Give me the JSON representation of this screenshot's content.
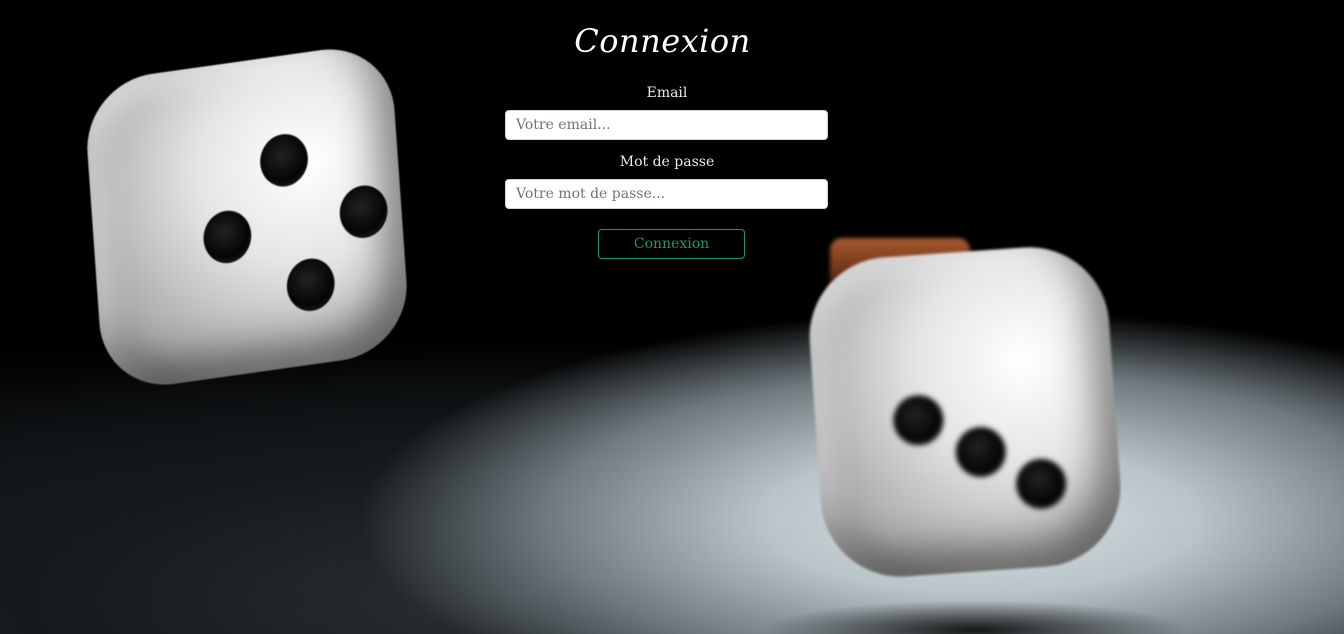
{
  "page": {
    "title": "Connexion"
  },
  "form": {
    "email": {
      "label": "Email",
      "placeholder": "Votre email...",
      "value": ""
    },
    "password": {
      "label": "Mot de passe",
      "placeholder": "Votre mot de passe...",
      "value": ""
    },
    "submit_label": "Connexion"
  },
  "background": {
    "image": "dice-scene",
    "colors": {
      "accent": "#1f9a5f",
      "text": "#ffffff"
    }
  }
}
